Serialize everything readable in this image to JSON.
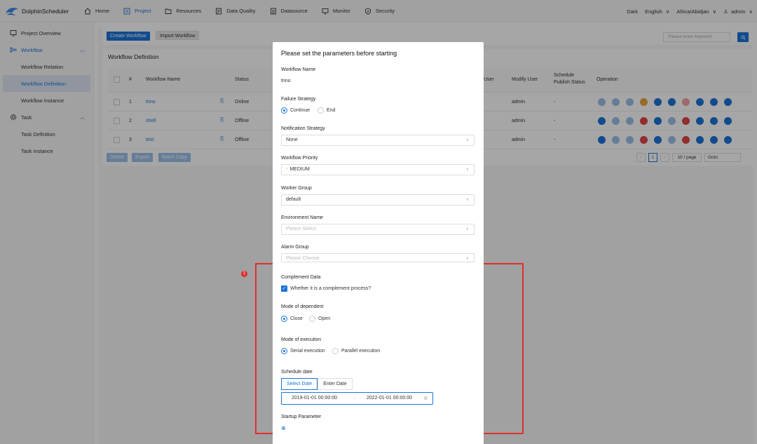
{
  "brand": {
    "name": "DolphinScheduler"
  },
  "nav": {
    "items": [
      {
        "label": "Home",
        "icon": "home-icon"
      },
      {
        "label": "Project",
        "icon": "project-icon",
        "active": true
      },
      {
        "label": "Resources",
        "icon": "folder-icon"
      },
      {
        "label": "Data Quality",
        "icon": "data-quality-icon"
      },
      {
        "label": "Datasource",
        "icon": "datasource-icon"
      },
      {
        "label": "Monitor",
        "icon": "monitor-icon"
      },
      {
        "label": "Security",
        "icon": "shield-icon"
      }
    ],
    "theme": "Dark",
    "language": "English",
    "timezone": "Africa/Abidjan",
    "user": "admin"
  },
  "sidebar": {
    "project_overview": "Project Overview",
    "workflow": "Workflow",
    "workflow_relation": "Workflow Relation",
    "workflow_definition": "Workflow Definition",
    "workflow_instance": "Workflow Instance",
    "task": "Task",
    "task_definition": "Task Definition",
    "task_instance": "Task Instance"
  },
  "toolbar": {
    "create_workflow": "Create Workflow",
    "import_workflow": "Import Workflow",
    "search_placeholder": "Please enter keyword"
  },
  "table": {
    "title": "Workflow Definition",
    "headers": {
      "num": "#",
      "name": "Workflow Name",
      "status": "Status",
      "create_user": "User",
      "modify_user": "Modify User",
      "schedule_line1": "Schedule",
      "schedule_line2": "Publish Status",
      "operation": "Operation"
    },
    "rows": [
      {
        "num": "1",
        "name": "trino",
        "status": "Online",
        "modify_user": "admin",
        "schedule": "-"
      },
      {
        "num": "2",
        "name": "shell",
        "status": "Offline",
        "modify_user": "admin",
        "schedule": "-"
      },
      {
        "num": "3",
        "name": "test",
        "status": "Offline",
        "modify_user": "admin",
        "schedule": "-"
      }
    ],
    "footer": {
      "delete": "Delete",
      "export": "Export",
      "batch_copy": "Batch Copy"
    },
    "pager": {
      "prev": "‹",
      "page": "1",
      "next": "›",
      "page_size": "10 / page",
      "goto": "Goto"
    }
  },
  "modal": {
    "title": "Please set the parameters before starting",
    "workflow_name_label": "Workflow Name",
    "workflow_name_value": "trino",
    "failure_strategy_label": "Failure Strategy",
    "failure_continue": "Continue",
    "failure_end": "End",
    "notification_label": "Notification Strategy",
    "notification_value": "None",
    "priority_label": "Workflow Priority",
    "priority_value": "MEDIUM",
    "worker_group_label": "Worker Group",
    "worker_group_value": "default",
    "environment_label": "Environment Name",
    "environment_placeholder": "Please Select",
    "alarm_label": "Alarm Group",
    "alarm_placeholder": "Please Choose",
    "complement_label": "Complement Data",
    "complement_checkbox": "Whether it is a complement process?",
    "dependent_label": "Mode of dependent",
    "dependent_close": "Close",
    "dependent_open": "Open",
    "execution_label": "Mode of execution",
    "execution_serial": "Serial execution",
    "execution_parallel": "Parallel execution",
    "schedule_label": "Schedule date",
    "tab_select_date": "Select Date",
    "tab_enter_date": "Enter Date",
    "start_date": "2019-01-01 00:00:00",
    "range_arrow": "→",
    "end_date": "2022-01-01 00:00:00",
    "startup_label": "Startup Parameter"
  },
  "annotation": {
    "badge": "1"
  },
  "colors": {
    "primary": "#1b74d9",
    "annotation": "#e02f2f",
    "orange": "#e8a33b",
    "red": "#e0454b"
  }
}
